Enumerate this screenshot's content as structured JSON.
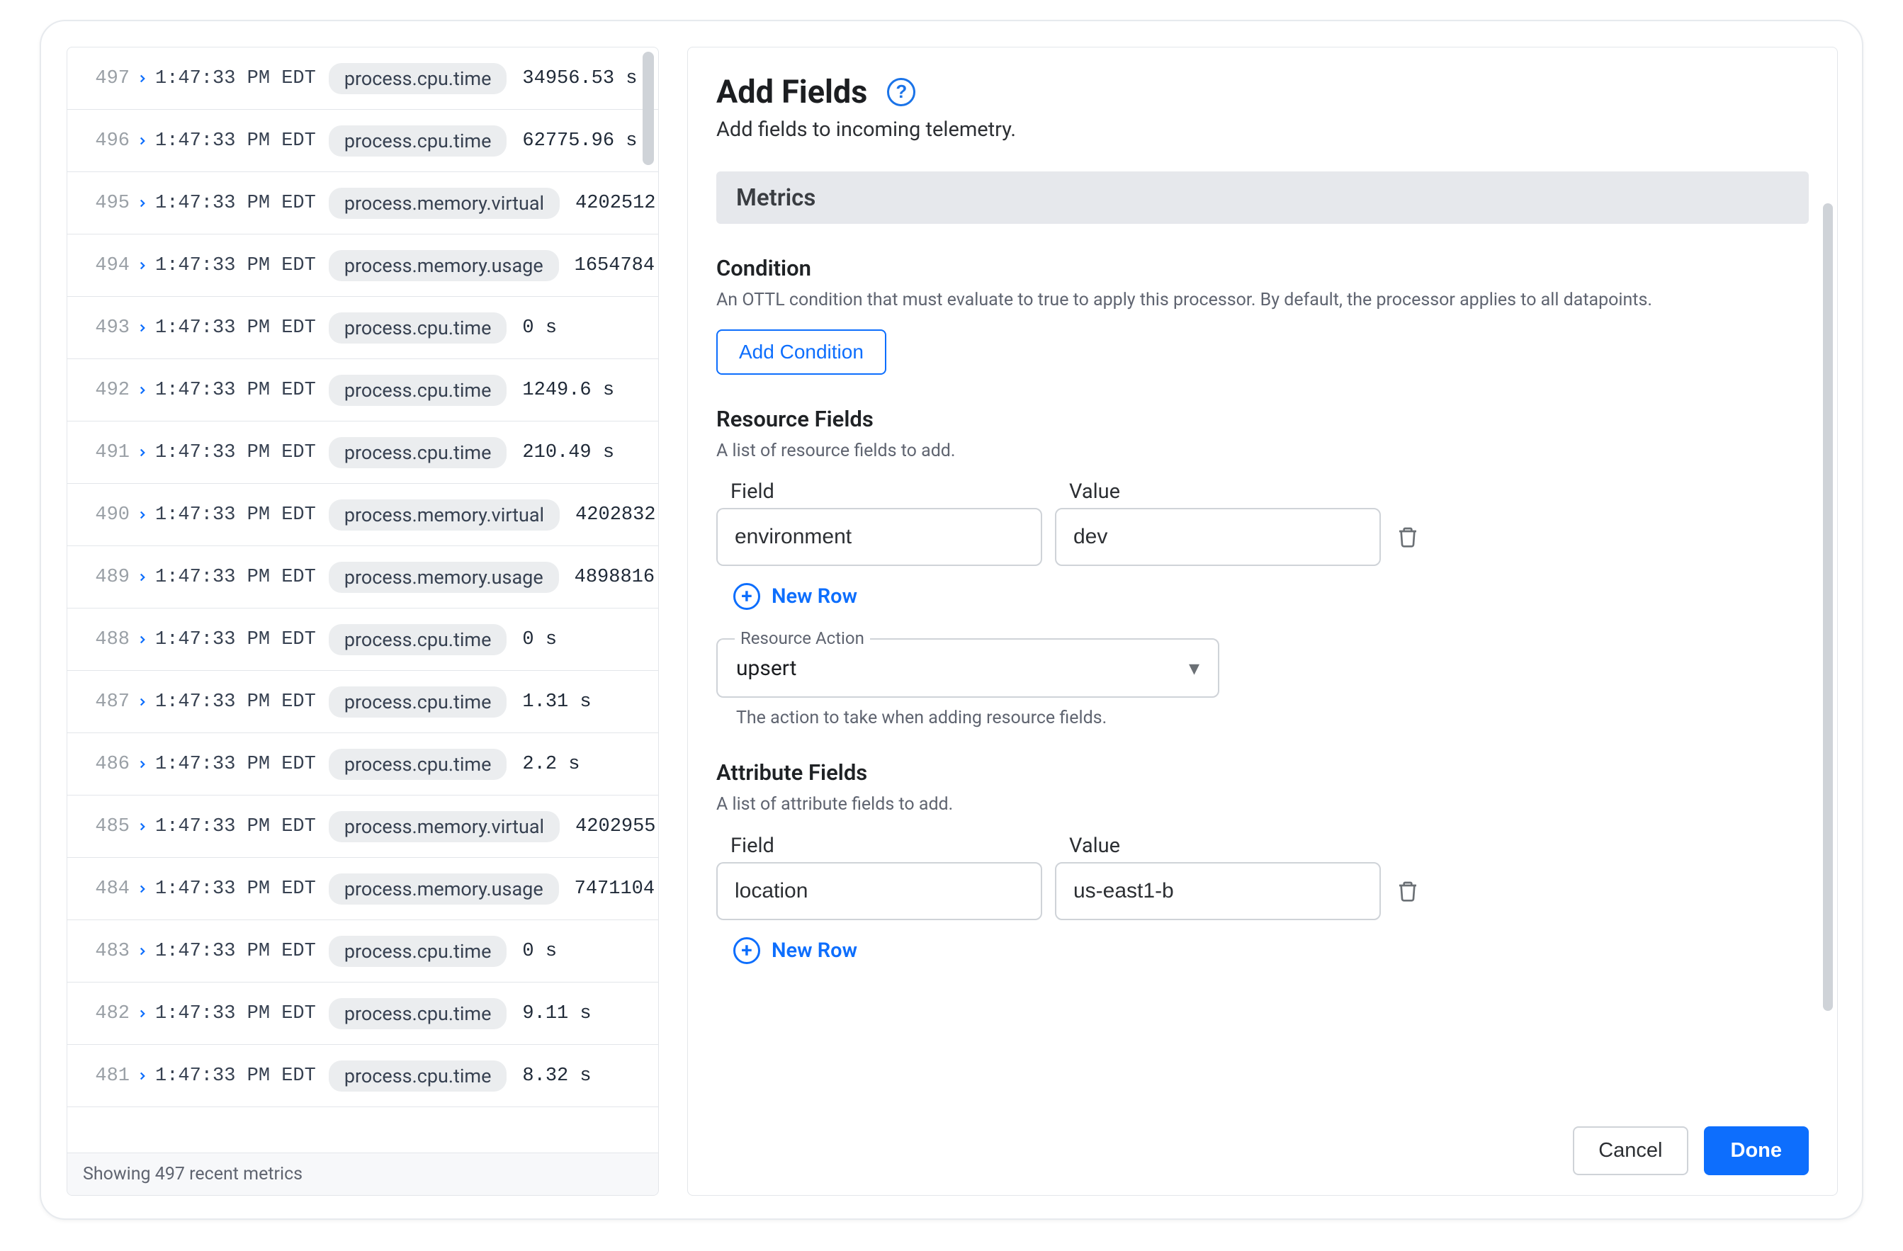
{
  "metrics": {
    "footer": "Showing 497 recent metrics",
    "rows": [
      {
        "n": "497",
        "ts": "1:47:33 PM EDT",
        "tag": "process.cpu.time",
        "val": "34956.53 s"
      },
      {
        "n": "496",
        "ts": "1:47:33 PM EDT",
        "tag": "process.cpu.time",
        "val": "62775.96 s"
      },
      {
        "n": "495",
        "ts": "1:47:33 PM EDT",
        "tag": "process.memory.virtual",
        "val": "4202512"
      },
      {
        "n": "494",
        "ts": "1:47:33 PM EDT",
        "tag": "process.memory.usage",
        "val": "1654784"
      },
      {
        "n": "493",
        "ts": "1:47:33 PM EDT",
        "tag": "process.cpu.time",
        "val": "0 s"
      },
      {
        "n": "492",
        "ts": "1:47:33 PM EDT",
        "tag": "process.cpu.time",
        "val": "1249.6 s"
      },
      {
        "n": "491",
        "ts": "1:47:33 PM EDT",
        "tag": "process.cpu.time",
        "val": "210.49 s"
      },
      {
        "n": "490",
        "ts": "1:47:33 PM EDT",
        "tag": "process.memory.virtual",
        "val": "4202832"
      },
      {
        "n": "489",
        "ts": "1:47:33 PM EDT",
        "tag": "process.memory.usage",
        "val": "4898816"
      },
      {
        "n": "488",
        "ts": "1:47:33 PM EDT",
        "tag": "process.cpu.time",
        "val": "0 s"
      },
      {
        "n": "487",
        "ts": "1:47:33 PM EDT",
        "tag": "process.cpu.time",
        "val": "1.31 s"
      },
      {
        "n": "486",
        "ts": "1:47:33 PM EDT",
        "tag": "process.cpu.time",
        "val": "2.2 s"
      },
      {
        "n": "485",
        "ts": "1:47:33 PM EDT",
        "tag": "process.memory.virtual",
        "val": "4202955"
      },
      {
        "n": "484",
        "ts": "1:47:33 PM EDT",
        "tag": "process.memory.usage",
        "val": "7471104"
      },
      {
        "n": "483",
        "ts": "1:47:33 PM EDT",
        "tag": "process.cpu.time",
        "val": "0 s"
      },
      {
        "n": "482",
        "ts": "1:47:33 PM EDT",
        "tag": "process.cpu.time",
        "val": "9.11 s"
      },
      {
        "n": "481",
        "ts": "1:47:33 PM EDT",
        "tag": "process.cpu.time",
        "val": "8.32 s"
      }
    ]
  },
  "form": {
    "title": "Add Fields",
    "subtitle": "Add fields to incoming telemetry.",
    "section_header": "Metrics",
    "condition": {
      "title": "Condition",
      "desc": "An OTTL condition that must evaluate to true to apply this processor. By default, the processor applies to all datapoints.",
      "button": "Add Condition"
    },
    "resource": {
      "title": "Resource Fields",
      "desc": "A list of resource fields to add.",
      "field_label": "Field",
      "value_label": "Value",
      "field": "environment",
      "value": "dev",
      "new_row": "New Row",
      "action_label": "Resource Action",
      "action_value": "upsert",
      "action_help": "The action to take when adding resource fields."
    },
    "attribute": {
      "title": "Attribute Fields",
      "desc": "A list of attribute fields to add.",
      "field_label": "Field",
      "value_label": "Value",
      "field": "location",
      "value": "us-east1-b",
      "new_row": "New Row"
    },
    "cancel": "Cancel",
    "done": "Done"
  }
}
